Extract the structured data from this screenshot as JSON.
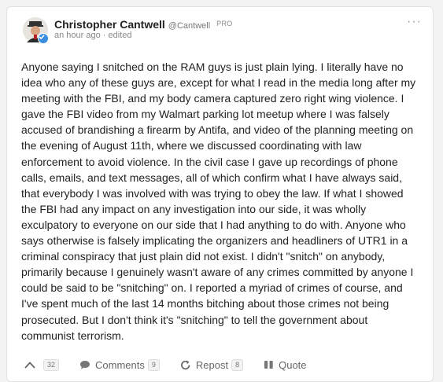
{
  "post": {
    "author_name": "Christopher Cantwell",
    "author_handle": "@Cantwell",
    "badge": "PRO",
    "timestamp": "an hour ago",
    "separator": "·",
    "edited_label": "edited",
    "menu_glyph": "···",
    "body": "Anyone saying I snitched on the RAM guys is just plain lying. I literally have no idea who any of these guys are, except for what I read in the media long after my meeting with the FBI, and my body camera captured zero right wing violence. I gave the FBI video from my Walmart parking lot meetup where I was falsely accused of brandishing a firearm by Antifa, and video of the planning meeting on the evening of August 11th, where we discussed coordinating with law enforcement to avoid violence. In the civil case I gave up recordings of phone calls, emails, and text messages, all of which confirm what I have always said, that everybody I was involved with was trying to obey the law. If what I showed the FBI had any impact on any investigation into our side, it was wholly exculpatory to everyone on our side that I had anything to do with. Anyone who says otherwise is falsely implicating the organizers and headliners of UTR1 in a criminal conspiracy that just plain did not exist. I didn't \"snitch\" on anybody, primarily because I genuinely wasn't aware of any crimes committed by anyone I could be said to be \"snitching\" on. I reported a myriad of crimes of course, and I've spent much of the last 14 months bitching about those crimes not being prosecuted. But I don't think it's \"snitching\" to tell the government about communist terrorism."
  },
  "actions": {
    "upvote_count": "32",
    "comments_label": "Comments",
    "comments_count": "9",
    "repost_label": "Repost",
    "repost_count": "8",
    "quote_label": "Quote"
  },
  "icons": {
    "upvote": "chevron-up-icon",
    "comments": "speech-bubble-icon",
    "repost": "repost-arrows-icon",
    "quote": "quote-icon",
    "verified": "verified-check-icon"
  },
  "colors": {
    "verified_badge": "#3a8de0",
    "text": "#222222",
    "muted": "#888888"
  }
}
